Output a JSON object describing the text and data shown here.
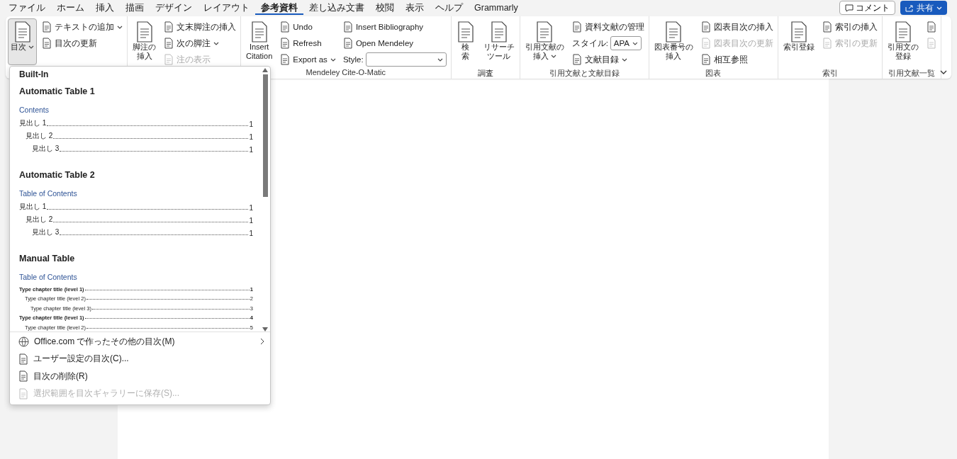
{
  "tabs": [
    {
      "label": "ファイル",
      "selected": false
    },
    {
      "label": "ホーム",
      "selected": false
    },
    {
      "label": "挿入",
      "selected": false
    },
    {
      "label": "描画",
      "selected": false
    },
    {
      "label": "デザイン",
      "selected": false
    },
    {
      "label": "レイアウト",
      "selected": false
    },
    {
      "label": "参考資料",
      "selected": true
    },
    {
      "label": "差し込み文書",
      "selected": false
    },
    {
      "label": "校閲",
      "selected": false
    },
    {
      "label": "表示",
      "selected": false
    },
    {
      "label": "ヘルプ",
      "selected": false
    },
    {
      "label": "Grammarly",
      "selected": false
    }
  ],
  "comment_button": {
    "label": "コメント"
  },
  "share_button": {
    "label": "共有"
  },
  "ribbon": {
    "groups": [
      {
        "columns": [
          {
            "kind": "large",
            "lines": [
              "目次"
            ],
            "caret": true,
            "expanded": true
          },
          {
            "kind": "stack",
            "items": [
              {
                "kind": "button",
                "label": "テキストの追加",
                "caret": true,
                "disabled": false
              },
              {
                "kind": "button",
                "label": "目次の更新",
                "caret": false,
                "disabled": false
              }
            ]
          }
        ]
      },
      {
        "columns": [
          {
            "kind": "large",
            "lines": [
              "脚注の",
              "挿入"
            ],
            "caret": false,
            "expanded": false
          },
          {
            "kind": "stack",
            "items": [
              {
                "kind": "button",
                "label": "文末脚注の挿入",
                "caret": false,
                "disabled": false
              },
              {
                "kind": "button",
                "label": "次の脚注",
                "caret": true,
                "disabled": false
              },
              {
                "kind": "button",
                "label": "注の表示",
                "caret": false,
                "disabled": true
              }
            ]
          }
        ]
      },
      {
        "label": "Mendeley Cite-O-Matic",
        "columns": [
          {
            "kind": "large",
            "lines": [
              "Insert",
              "Citation"
            ],
            "caret": false,
            "expanded": false
          },
          {
            "kind": "stack",
            "items": [
              {
                "kind": "button",
                "label": "Undo",
                "caret": false,
                "disabled": false
              },
              {
                "kind": "button",
                "label": "Refresh",
                "caret": false,
                "disabled": false
              },
              {
                "kind": "button",
                "label": "Export as",
                "caret": true,
                "disabled": false
              }
            ]
          },
          {
            "kind": "stack",
            "items": [
              {
                "kind": "button",
                "label": "Insert Bibliography",
                "caret": false,
                "disabled": false
              },
              {
                "kind": "button",
                "label": "Open Mendeley",
                "caret": false,
                "disabled": false
              },
              {
                "kind": "select",
                "label": "Style:"
              }
            ]
          }
        ]
      },
      {
        "label": "調査",
        "columns": [
          {
            "kind": "large",
            "lines": [
              "検",
              "索"
            ],
            "caret": false,
            "expanded": false
          },
          {
            "kind": "large",
            "lines": [
              "リサーチ",
              "ツール"
            ],
            "caret": false,
            "expanded": false
          }
        ]
      },
      {
        "label": "引用文献と文献目録",
        "columns": [
          {
            "kind": "large",
            "lines": [
              "引用文献の",
              "挿入"
            ],
            "caret": true,
            "expanded": false
          },
          {
            "kind": "stack",
            "items": [
              {
                "kind": "button",
                "label": "資料文献の管理",
                "caret": false,
                "disabled": false
              },
              {
                "kind": "select",
                "label": "スタイル:",
                "value": "APA"
              },
              {
                "kind": "button",
                "label": "文献目録",
                "caret": true,
                "disabled": false
              }
            ]
          }
        ]
      },
      {
        "label": "図表",
        "columns": [
          {
            "kind": "large",
            "lines": [
              "図表番号の",
              "挿入"
            ],
            "caret": false,
            "expanded": false
          },
          {
            "kind": "stack",
            "items": [
              {
                "kind": "button",
                "label": "図表目次の挿入",
                "caret": false,
                "disabled": false
              },
              {
                "kind": "button",
                "label": "図表目次の更新",
                "caret": false,
                "disabled": true
              },
              {
                "kind": "button",
                "label": "相互参照",
                "caret": false,
                "disabled": false
              }
            ]
          }
        ]
      },
      {
        "label": "索引",
        "columns": [
          {
            "kind": "large",
            "lines": [
              "索引登録"
            ],
            "caret": false,
            "expanded": false
          },
          {
            "kind": "stack",
            "items": [
              {
                "kind": "button",
                "label": "索引の挿入",
                "caret": false,
                "disabled": false
              },
              {
                "kind": "button",
                "label": "索引の更新",
                "caret": false,
                "disabled": true
              }
            ]
          }
        ]
      },
      {
        "label": "引用文献一覧",
        "columns": [
          {
            "kind": "large",
            "lines": [
              "引用文の",
              "登録"
            ],
            "caret": false,
            "expanded": false
          },
          {
            "kind": "stack",
            "items": [
              {
                "kind": "icon",
                "disabled": false
              },
              {
                "kind": "icon",
                "disabled": true
              }
            ]
          }
        ]
      }
    ]
  },
  "toc_gallery": {
    "header": "Built-In",
    "sections": [
      {
        "kind": "automatic",
        "title": "Automatic Table 1",
        "heading": "Contents",
        "entries": [
          {
            "text": "見出し 1",
            "page": "1",
            "children": [
              {
                "text": "見出し 2",
                "page": "1",
                "children": [
                  {
                    "text": "見出し 3",
                    "page": "1"
                  }
                ]
              }
            ]
          }
        ]
      },
      {
        "kind": "automatic",
        "title": "Automatic Table 2",
        "heading": "Table of Contents",
        "entries": [
          {
            "text": "見出し 1",
            "page": "1",
            "children": [
              {
                "text": "見出し 2",
                "page": "1",
                "children": [
                  {
                    "text": "見出し 3",
                    "page": "1"
                  }
                ]
              }
            ]
          }
        ]
      },
      {
        "kind": "manual",
        "title": "Manual Table",
        "heading": "Table of Contents",
        "entries": [
          {
            "text": "Type chapter title (level 1)",
            "page": "1",
            "children": [
              {
                "text": "Type chapter title (level 2)",
                "page": "2",
                "children": [
                  {
                    "text": "Type chapter title (level 3)",
                    "page": "3"
                  }
                ]
              }
            ]
          },
          {
            "text": "Type chapter title (level 1)",
            "page": "4",
            "children": [
              {
                "text": "Type chapter title (level 2)",
                "page": "5"
              }
            ]
          }
        ]
      }
    ],
    "menu": [
      {
        "label": "Office.com で作ったその他の目次(M)",
        "submenu": true,
        "disabled": false
      },
      {
        "label": "ユーザー設定の目次(C)...",
        "submenu": false,
        "disabled": false
      },
      {
        "label": "目次の削除(R)",
        "submenu": false,
        "disabled": false
      },
      {
        "label": "選択範囲を目次ギャラリーに保存(S)...",
        "submenu": false,
        "disabled": true
      }
    ]
  }
}
